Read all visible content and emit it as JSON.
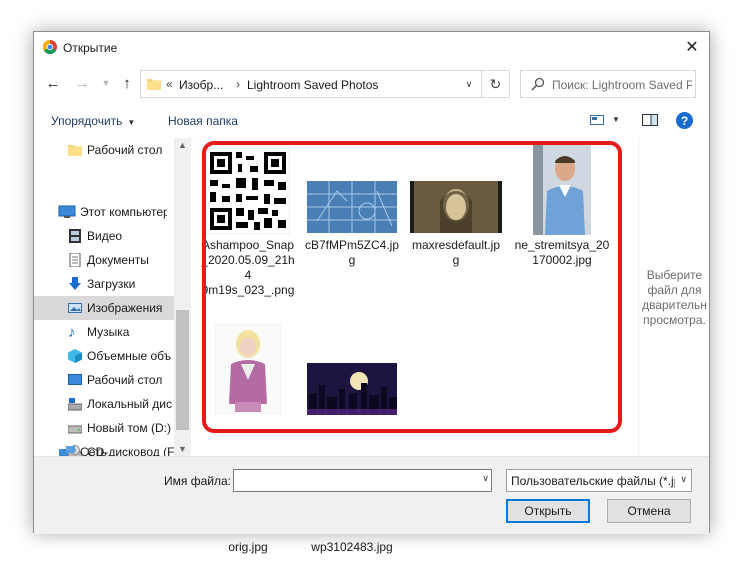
{
  "window": {
    "title": "Открытие"
  },
  "address": {
    "segments": [
      "Изобр...",
      "Lightroom Saved Photos"
    ],
    "search_placeholder": "Поиск: Lightroom Saved Ph..."
  },
  "toolbar": {
    "organize": "Упорядочить",
    "new_folder": "Новая папка"
  },
  "sidebar": {
    "items": [
      {
        "label": "Рабочий стол",
        "icon": "folder-yellow-icon"
      },
      {
        "label": "Этот компьютер",
        "icon": "computer-icon"
      },
      {
        "label": "Видео",
        "icon": "video-icon"
      },
      {
        "label": "Документы",
        "icon": "documents-icon"
      },
      {
        "label": "Загрузки",
        "icon": "downloads-icon"
      },
      {
        "label": "Изображения",
        "icon": "pictures-icon"
      },
      {
        "label": "Музыка",
        "icon": "music-icon"
      },
      {
        "label": "Объемные объ",
        "icon": "3d-objects-icon"
      },
      {
        "label": "Рабочий стол",
        "icon": "desktop-icon"
      },
      {
        "label": "Локальный дис",
        "icon": "local-disk-icon"
      },
      {
        "label": "Новый том (D:)",
        "icon": "drive-icon"
      },
      {
        "label": "CD-дисковод (F",
        "icon": "cd-drive-icon"
      },
      {
        "label": "Сеть",
        "icon": "network-icon"
      }
    ]
  },
  "files": [
    {
      "name_lines": [
        "Ashampoo_Snap",
        "_2020.05.09_21h4",
        "9m19s_023_.png"
      ],
      "thumb": "qr-code"
    },
    {
      "name_lines": [
        "cB7fMPm5ZC4.jp",
        "g"
      ],
      "thumb": "blue-blueprint"
    },
    {
      "name_lines": [
        "maxresdefault.jp",
        "g"
      ],
      "thumb": "sepia-portrait"
    },
    {
      "name_lines": [
        "ne_stremitsya_20",
        "170002.jpg"
      ],
      "thumb": "man-photo"
    },
    {
      "name_lines": [
        "orig.jpg"
      ],
      "thumb": "girl-drawing"
    },
    {
      "name_lines": [
        "wp3102483.jpg"
      ],
      "thumb": "night-city"
    }
  ],
  "preview": {
    "lines": [
      "Выберите",
      "файл для",
      "дварительн",
      "просмотра."
    ]
  },
  "bottom": {
    "file_name_label": "Имя файла:",
    "file_name_value": "",
    "file_type": "Пользовательские файлы (*.jp",
    "open_label": "Открыть",
    "cancel_label": "Отмена"
  },
  "colors": {
    "highlight_frame": "#e81a1a",
    "accent": "#0078d7"
  }
}
